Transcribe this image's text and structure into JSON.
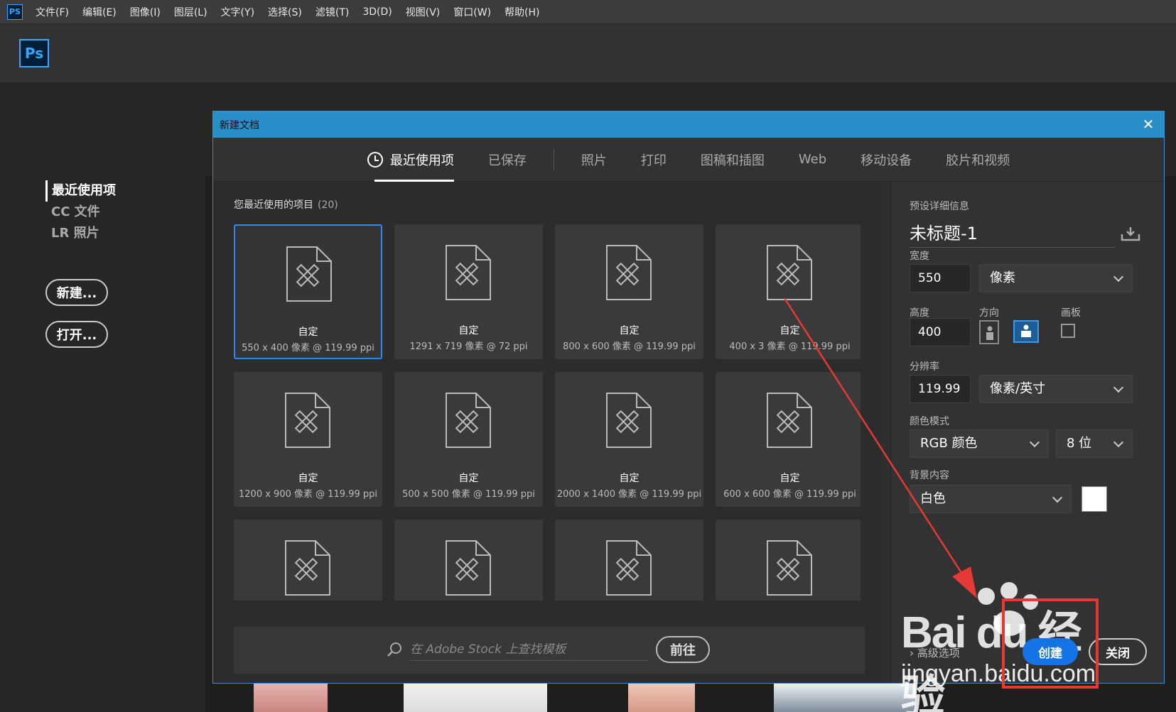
{
  "menubar": {
    "app_icon": "PS",
    "items": [
      "文件(F)",
      "编辑(E)",
      "图像(I)",
      "图层(L)",
      "文字(Y)",
      "选择(S)",
      "滤镜(T)",
      "3D(D)",
      "视图(V)",
      "窗口(W)",
      "帮助(H)"
    ]
  },
  "app": {
    "logo": "Ps"
  },
  "start": {
    "nav": [
      "最近使用项",
      "CC 文件",
      "LR 照片"
    ],
    "new_button": "新建...",
    "open_button": "打开..."
  },
  "dialog": {
    "title": "新建文档",
    "close_icon": "close-icon",
    "tabs": [
      "最近使用项",
      "已保存",
      "照片",
      "打印",
      "图稿和插图",
      "Web",
      "移动设备",
      "胶片和视频"
    ],
    "recent_label": "您最近使用的项目",
    "recent_count": "(20)",
    "presets": [
      {
        "name": "自定",
        "size": "550 x 400 像素 @ 119.99 ppi"
      },
      {
        "name": "自定",
        "size": "1291 x 719 像素 @ 72 ppi"
      },
      {
        "name": "自定",
        "size": "800 x 600 像素 @ 119.99 ppi"
      },
      {
        "name": "自定",
        "size": "400 x 3 像素 @ 119.99 ppi"
      },
      {
        "name": "自定",
        "size": "1200 x 900 像素 @ 119.99 ppi"
      },
      {
        "name": "自定",
        "size": "500 x 500 像素 @ 119.99 ppi"
      },
      {
        "name": "自定",
        "size": "2000 x 1400 像素 @ 119.99 ppi"
      },
      {
        "name": "自定",
        "size": "600 x 600 像素 @ 119.99 ppi"
      },
      {
        "name": "",
        "size": ""
      },
      {
        "name": "",
        "size": ""
      },
      {
        "name": "",
        "size": ""
      },
      {
        "name": "",
        "size": ""
      }
    ],
    "stock": {
      "placeholder": "在 Adobe Stock 上查找模板",
      "go_button": "前往"
    },
    "details": {
      "section_label": "预设详细信息",
      "doc_name": "未标题-1",
      "width_label": "宽度",
      "width_value": "550",
      "width_unit": "像素",
      "height_label": "高度",
      "height_value": "400",
      "orientation_label": "方向",
      "artboard_label": "画板",
      "resolution_label": "分辨率",
      "resolution_value": "119.99",
      "resolution_unit": "像素/英寸",
      "color_mode_label": "颜色模式",
      "color_mode": "RGB 颜色",
      "bit_depth": "8 位",
      "background_label": "背景内容",
      "background": "白色",
      "advanced": "高级选项"
    },
    "create_button": "创建",
    "close_button": "关闭"
  },
  "watermark": {
    "brand": "Bai du 经验",
    "url": "jingyan.baidu.com"
  },
  "colors": {
    "accent": "#1473e6",
    "title_bar": "#2a8fc9",
    "annotation": "#e53935"
  }
}
